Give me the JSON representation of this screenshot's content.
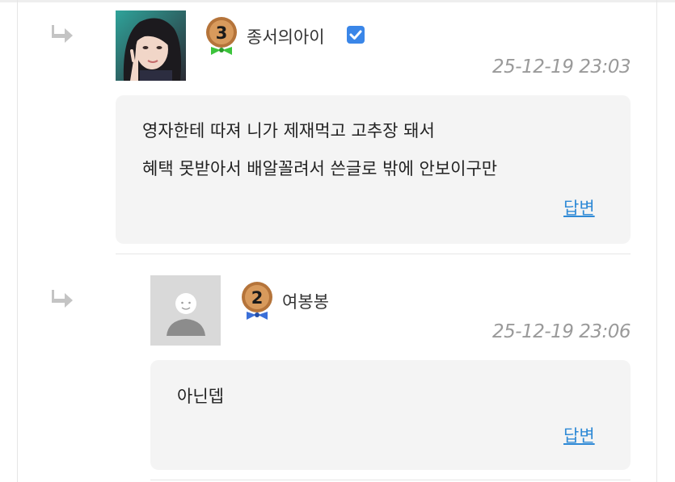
{
  "comments": [
    {
      "nickname": "종서의아이",
      "level": "3",
      "verified": true,
      "datetime": "25-12-19 23:03",
      "lines": [
        "영자한테 따져 니가 제재먹고 고추장 돼서",
        "혜택 못받아서 배알꼴려서 쓴글로 밖에 안보이구만"
      ],
      "reply_label": "답변"
    },
    {
      "nickname": "여봉봉",
      "level": "2",
      "verified": false,
      "datetime": "25-12-19 23:06",
      "lines": [
        "아닌뎁"
      ],
      "reply_label": "답변"
    }
  ],
  "colors": {
    "link": "#2f8ad6",
    "bubble": "#f4f4f4",
    "date": "#9a9a9a",
    "verified": "#3a86e8",
    "badge_bronze": "#b5743a",
    "bow_green": "#3cc43c",
    "bow_blue": "#3a6fd8"
  },
  "icons": {
    "reply_indicator": "reply-arrow-icon",
    "verified": "check-badge-icon",
    "default_avatar": "default-profile-icon"
  }
}
